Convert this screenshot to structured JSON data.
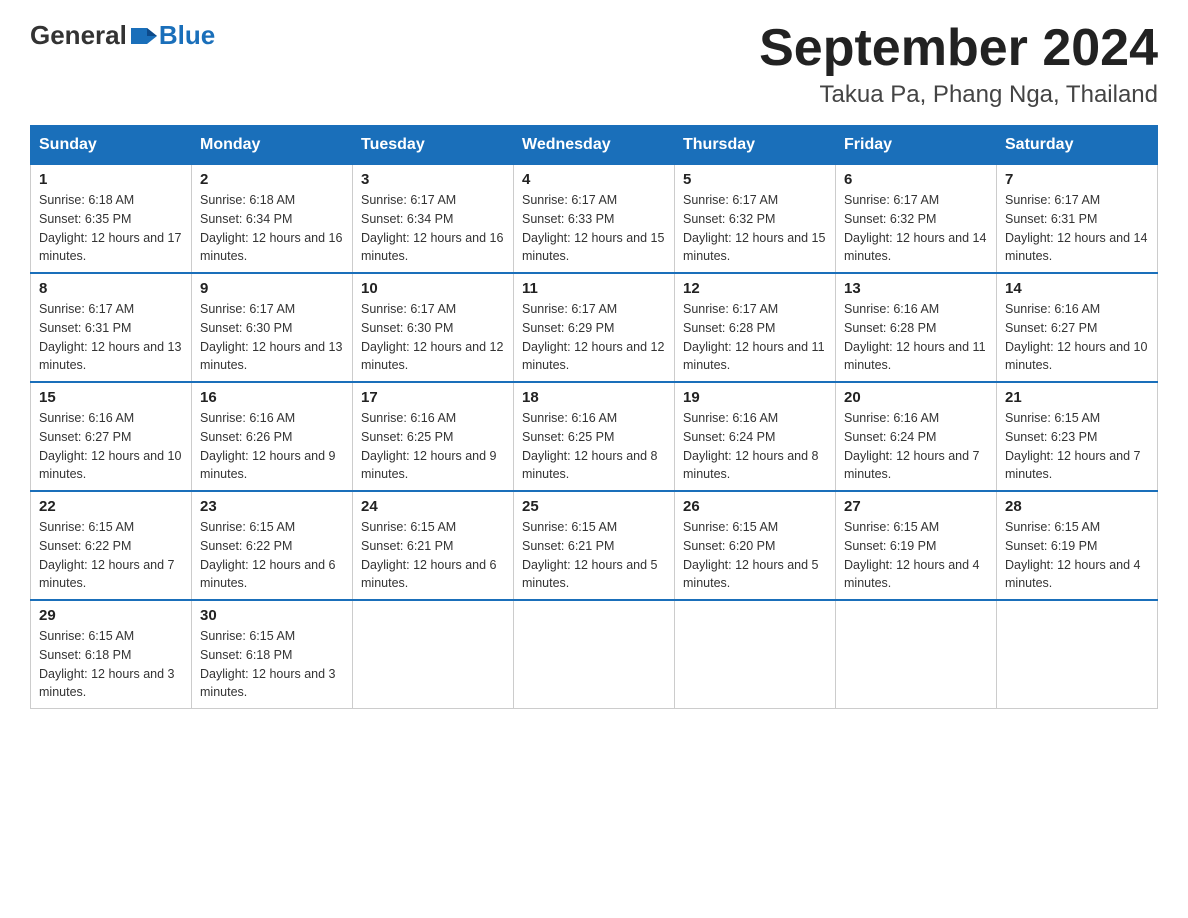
{
  "header": {
    "logo_general": "General",
    "logo_blue": "Blue",
    "month_title": "September 2024",
    "location": "Takua Pa, Phang Nga, Thailand"
  },
  "weekdays": [
    "Sunday",
    "Monday",
    "Tuesday",
    "Wednesday",
    "Thursday",
    "Friday",
    "Saturday"
  ],
  "weeks": [
    [
      {
        "day": "1",
        "sunrise": "6:18 AM",
        "sunset": "6:35 PM",
        "daylight": "12 hours and 17 minutes."
      },
      {
        "day": "2",
        "sunrise": "6:18 AM",
        "sunset": "6:34 PM",
        "daylight": "12 hours and 16 minutes."
      },
      {
        "day": "3",
        "sunrise": "6:17 AM",
        "sunset": "6:34 PM",
        "daylight": "12 hours and 16 minutes."
      },
      {
        "day": "4",
        "sunrise": "6:17 AM",
        "sunset": "6:33 PM",
        "daylight": "12 hours and 15 minutes."
      },
      {
        "day": "5",
        "sunrise": "6:17 AM",
        "sunset": "6:32 PM",
        "daylight": "12 hours and 15 minutes."
      },
      {
        "day": "6",
        "sunrise": "6:17 AM",
        "sunset": "6:32 PM",
        "daylight": "12 hours and 14 minutes."
      },
      {
        "day": "7",
        "sunrise": "6:17 AM",
        "sunset": "6:31 PM",
        "daylight": "12 hours and 14 minutes."
      }
    ],
    [
      {
        "day": "8",
        "sunrise": "6:17 AM",
        "sunset": "6:31 PM",
        "daylight": "12 hours and 13 minutes."
      },
      {
        "day": "9",
        "sunrise": "6:17 AM",
        "sunset": "6:30 PM",
        "daylight": "12 hours and 13 minutes."
      },
      {
        "day": "10",
        "sunrise": "6:17 AM",
        "sunset": "6:30 PM",
        "daylight": "12 hours and 12 minutes."
      },
      {
        "day": "11",
        "sunrise": "6:17 AM",
        "sunset": "6:29 PM",
        "daylight": "12 hours and 12 minutes."
      },
      {
        "day": "12",
        "sunrise": "6:17 AM",
        "sunset": "6:28 PM",
        "daylight": "12 hours and 11 minutes."
      },
      {
        "day": "13",
        "sunrise": "6:16 AM",
        "sunset": "6:28 PM",
        "daylight": "12 hours and 11 minutes."
      },
      {
        "day": "14",
        "sunrise": "6:16 AM",
        "sunset": "6:27 PM",
        "daylight": "12 hours and 10 minutes."
      }
    ],
    [
      {
        "day": "15",
        "sunrise": "6:16 AM",
        "sunset": "6:27 PM",
        "daylight": "12 hours and 10 minutes."
      },
      {
        "day": "16",
        "sunrise": "6:16 AM",
        "sunset": "6:26 PM",
        "daylight": "12 hours and 9 minutes."
      },
      {
        "day": "17",
        "sunrise": "6:16 AM",
        "sunset": "6:25 PM",
        "daylight": "12 hours and 9 minutes."
      },
      {
        "day": "18",
        "sunrise": "6:16 AM",
        "sunset": "6:25 PM",
        "daylight": "12 hours and 8 minutes."
      },
      {
        "day": "19",
        "sunrise": "6:16 AM",
        "sunset": "6:24 PM",
        "daylight": "12 hours and 8 minutes."
      },
      {
        "day": "20",
        "sunrise": "6:16 AM",
        "sunset": "6:24 PM",
        "daylight": "12 hours and 7 minutes."
      },
      {
        "day": "21",
        "sunrise": "6:15 AM",
        "sunset": "6:23 PM",
        "daylight": "12 hours and 7 minutes."
      }
    ],
    [
      {
        "day": "22",
        "sunrise": "6:15 AM",
        "sunset": "6:22 PM",
        "daylight": "12 hours and 7 minutes."
      },
      {
        "day": "23",
        "sunrise": "6:15 AM",
        "sunset": "6:22 PM",
        "daylight": "12 hours and 6 minutes."
      },
      {
        "day": "24",
        "sunrise": "6:15 AM",
        "sunset": "6:21 PM",
        "daylight": "12 hours and 6 minutes."
      },
      {
        "day": "25",
        "sunrise": "6:15 AM",
        "sunset": "6:21 PM",
        "daylight": "12 hours and 5 minutes."
      },
      {
        "day": "26",
        "sunrise": "6:15 AM",
        "sunset": "6:20 PM",
        "daylight": "12 hours and 5 minutes."
      },
      {
        "day": "27",
        "sunrise": "6:15 AM",
        "sunset": "6:19 PM",
        "daylight": "12 hours and 4 minutes."
      },
      {
        "day": "28",
        "sunrise": "6:15 AM",
        "sunset": "6:19 PM",
        "daylight": "12 hours and 4 minutes."
      }
    ],
    [
      {
        "day": "29",
        "sunrise": "6:15 AM",
        "sunset": "6:18 PM",
        "daylight": "12 hours and 3 minutes."
      },
      {
        "day": "30",
        "sunrise": "6:15 AM",
        "sunset": "6:18 PM",
        "daylight": "12 hours and 3 minutes."
      },
      null,
      null,
      null,
      null,
      null
    ]
  ],
  "labels": {
    "sunrise_prefix": "Sunrise: ",
    "sunset_prefix": "Sunset: ",
    "daylight_prefix": "Daylight: "
  }
}
